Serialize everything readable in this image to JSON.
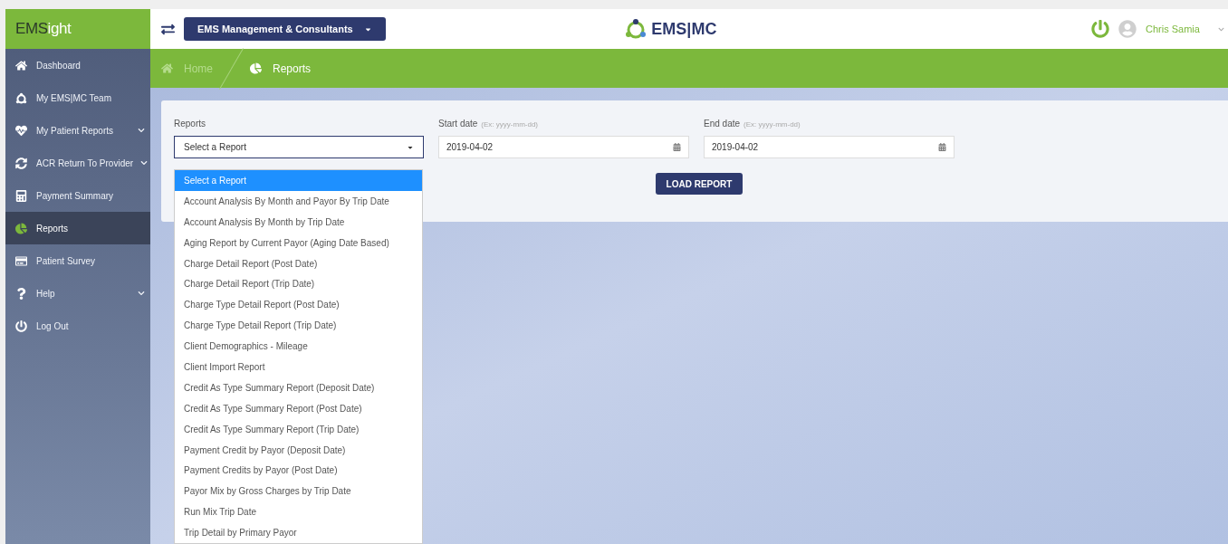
{
  "app": {
    "logo_dark": "EMS",
    "logo_light": "ight"
  },
  "header": {
    "company": "EMS Management & Consultants",
    "brand": "EMS|MC",
    "user": "Chris Samia"
  },
  "sidebar": {
    "items": [
      {
        "label": "Dashboard",
        "kind": "home",
        "selected": false,
        "has_submenu": false
      },
      {
        "label": "My EMS|MC Team",
        "kind": "ring",
        "selected": false,
        "has_submenu": false
      },
      {
        "label": "My Patient Reports",
        "kind": "heart",
        "selected": false,
        "has_submenu": true
      },
      {
        "label": "ACR Return To Provider",
        "kind": "sync",
        "selected": false,
        "has_submenu": true
      },
      {
        "label": "Payment Summary",
        "kind": "calculator",
        "selected": false,
        "has_submenu": false
      },
      {
        "label": "Reports",
        "kind": "pie",
        "selected": true,
        "has_submenu": false
      },
      {
        "label": "Patient Survey",
        "kind": "card",
        "selected": false,
        "has_submenu": false
      },
      {
        "label": "Help",
        "kind": "question",
        "selected": false,
        "has_submenu": true
      },
      {
        "label": "Log Out",
        "kind": "power",
        "selected": false,
        "has_submenu": false
      }
    ]
  },
  "breadcrumb": [
    {
      "label": "Home",
      "kind": "home",
      "current": false
    },
    {
      "label": "Reports",
      "kind": "pie",
      "current": true
    }
  ],
  "form": {
    "reports": {
      "label": "Reports",
      "value": "Select a Report",
      "expanded": true,
      "options": [
        {
          "label": "Select a Report",
          "selected": true
        },
        {
          "label": "Account Analysis By Month and Payor By Trip Date",
          "selected": false
        },
        {
          "label": "Account Analysis By Month by Trip Date",
          "selected": false
        },
        {
          "label": "Aging Report by Current Payor (Aging Date Based)",
          "selected": false
        },
        {
          "label": "Charge Detail Report (Post Date)",
          "selected": false
        },
        {
          "label": "Charge Detail Report (Trip Date)",
          "selected": false
        },
        {
          "label": "Charge Type Detail Report (Post Date)",
          "selected": false
        },
        {
          "label": "Charge Type Detail Report (Trip Date)",
          "selected": false
        },
        {
          "label": "Client Demographics - Mileage",
          "selected": false
        },
        {
          "label": "Client Import Report",
          "selected": false
        },
        {
          "label": "Credit As Type Summary Report (Deposit Date)",
          "selected": false
        },
        {
          "label": "Credit As Type Summary Report (Post Date)",
          "selected": false
        },
        {
          "label": "Credit As Type Summary Report (Trip Date)",
          "selected": false
        },
        {
          "label": "Payment Credit by Payor (Deposit Date)",
          "selected": false
        },
        {
          "label": "Payment Credits by Payor (Post Date)",
          "selected": false
        },
        {
          "label": "Payor Mix by Gross Charges by Trip Date",
          "selected": false
        },
        {
          "label": "Run Mix Trip Date",
          "selected": false
        },
        {
          "label": "Trip Detail by Primary Payor",
          "selected": false
        }
      ]
    },
    "dates": [
      {
        "label": "Start date",
        "hint": "(Ex: yyyy-mm-dd)",
        "value": "2019-04-02"
      },
      {
        "label": "End date",
        "hint": "(Ex: yyyy-mm-dd)",
        "value": "2019-04-02"
      }
    ],
    "button": "LOAD REPORT"
  }
}
